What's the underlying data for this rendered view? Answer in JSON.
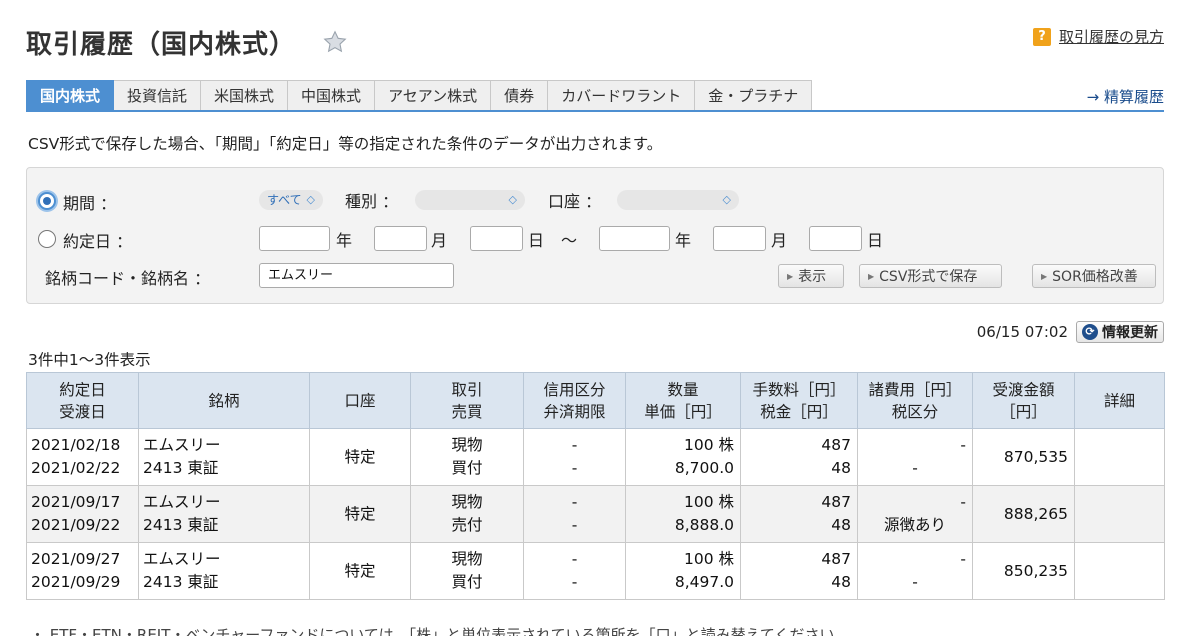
{
  "header": {
    "title": "取引履歴（国内株式）",
    "help_label": "取引履歴の見方",
    "help_icon_glyph": "?"
  },
  "tabs": [
    {
      "label": "国内株式",
      "active": true
    },
    {
      "label": "投資信託",
      "active": false
    },
    {
      "label": "米国株式",
      "active": false
    },
    {
      "label": "中国株式",
      "active": false
    },
    {
      "label": "アセアン株式",
      "active": false
    },
    {
      "label": "債券",
      "active": false
    },
    {
      "label": "カバードワラント",
      "active": false
    },
    {
      "label": "金・プラチナ",
      "active": false
    }
  ],
  "settlement_link": "→ 精算履歴",
  "csv_note": "CSV形式で保存した場合、「期間」「約定日」等の指定された条件のデータが出力されます。",
  "search": {
    "period_label": "期間 ：",
    "period_value": "すべて",
    "type_label": "種別 ：",
    "account_label": "口座 ：",
    "trade_date_label": "約定日 ：",
    "year_unit": "年",
    "month_unit": "月",
    "day_unit": "日",
    "range_sep": "〜",
    "symbol_label": "銘柄コード・銘柄名 ：",
    "symbol_value": "エムスリー",
    "display_button": "表示",
    "csv_button": "CSV形式で保存",
    "sor_button": "SOR価格改善"
  },
  "timestamp": "06/15 07:02",
  "refresh_label": "情報更新",
  "count_text": "3件中1〜3件表示",
  "table": {
    "headers": [
      [
        "約定日",
        "受渡日"
      ],
      [
        "銘柄"
      ],
      [
        "口座"
      ],
      [
        "取引",
        "売買"
      ],
      [
        "信用区分",
        "弁済期限"
      ],
      [
        "数量",
        "単価［円］"
      ],
      [
        "手数料［円］",
        "税金［円］"
      ],
      [
        "諸費用［円］",
        "税区分"
      ],
      [
        "受渡金額",
        "［円］"
      ],
      [
        "詳細"
      ]
    ],
    "rows": [
      {
        "trade_date": "2021/02/18",
        "settle_date": "2021/02/22",
        "name": "エムスリー",
        "code": "2413 東証",
        "account": "特定",
        "trade": "現物",
        "side": "買付",
        "margin": "-",
        "due": "-",
        "qty": "100 株",
        "price": "8,700.0",
        "fee": "487",
        "tax": "48",
        "expense": "-",
        "tax_class": "-",
        "amount": "870,535"
      },
      {
        "trade_date": "2021/09/17",
        "settle_date": "2021/09/22",
        "name": "エムスリー",
        "code": "2413 東証",
        "account": "特定",
        "trade": "現物",
        "side": "売付",
        "margin": "-",
        "due": "-",
        "qty": "100 株",
        "price": "8,888.0",
        "fee": "487",
        "tax": "48",
        "expense": "-",
        "tax_class": "源徴あり",
        "amount": "888,265"
      },
      {
        "trade_date": "2021/09/27",
        "settle_date": "2021/09/29",
        "name": "エムスリー",
        "code": "2413 東証",
        "account": "特定",
        "trade": "現物",
        "side": "買付",
        "margin": "-",
        "due": "-",
        "qty": "100 株",
        "price": "8,497.0",
        "fee": "487",
        "tax": "48",
        "expense": "-",
        "tax_class": "-",
        "amount": "850,235"
      }
    ]
  },
  "footnote": "・ ETF・ETN・REIT・ベンチャーファンドについては、「株」と単位表示されている箇所を「口」と読み替えてください。"
}
